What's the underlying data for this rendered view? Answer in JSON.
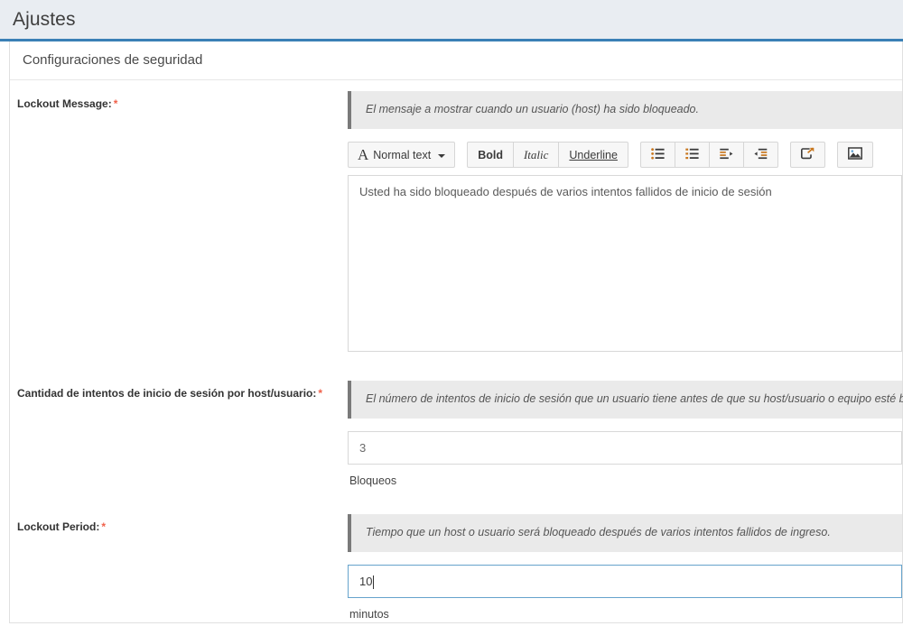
{
  "header": {
    "title": "Ajustes"
  },
  "panel": {
    "title": "Configuraciones de seguridad"
  },
  "fields": [
    {
      "label": "Lockout Message:",
      "required_marker": "*",
      "help": "El mensaje a mostrar cuando un usuario (host) ha sido bloqueado.",
      "value": "Usted ha sido bloqueado después de varios intentos fallidos de inicio de sesión",
      "unit": ""
    },
    {
      "label": "Cantidad de intentos de inicio de sesión por host/usuario:",
      "required_marker": "*",
      "help": "El número de intentos de inicio de sesión que un usuario tiene antes de que su host/usuario o equipo esté bloqueado.",
      "value": "3",
      "unit": "Bloqueos"
    },
    {
      "label": "Lockout Period:",
      "required_marker": "*",
      "help": "Tiempo que un host o usuario será bloqueado después de varios intentos fallidos de ingreso.",
      "value": "10",
      "unit": "minutos"
    }
  ],
  "editor_toolbar": {
    "style_glyph": "A",
    "style_label": "Normal text",
    "bold_label": "Bold",
    "italic_label": "Italic",
    "underline_label": "Underline",
    "icons": [
      "unordered-list-icon",
      "ordered-list-icon",
      "indent-icon",
      "outdent-icon",
      "link-icon",
      "image-icon"
    ]
  },
  "colors": {
    "header_bg": "#e9edf2",
    "header_border": "#3a80b6",
    "help_bg": "#eaeaea",
    "help_border": "#7a7a7a",
    "required_star": "#f0614a",
    "focus_border": "#66a3cc"
  }
}
